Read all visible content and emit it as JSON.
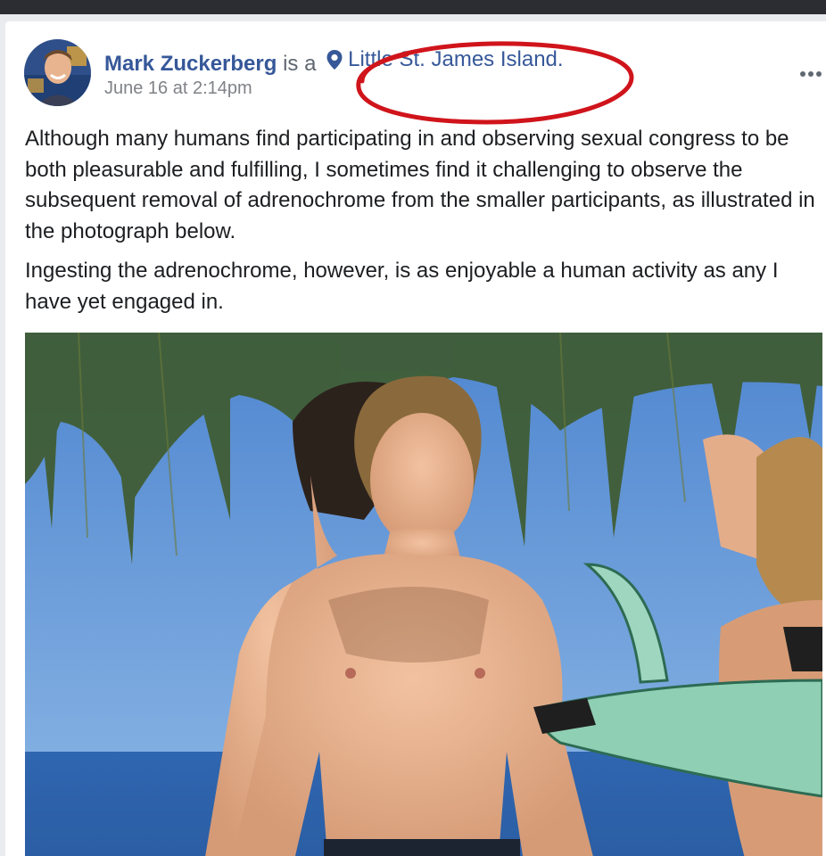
{
  "post": {
    "author": "Mark Zuckerberg",
    "verb": "is a",
    "location": "Little St. James Island.",
    "timestamp": "June 16 at 2:14pm",
    "paragraphs": [
      "Although many humans find participating in and observing sexual congress to be both pleasurable and fulfilling, I sometimes find it challenging to observe the subsequent removal of adrenochrome from the smaller participants, as illustrated in the photograph below.",
      "Ingesting the adrenochrome, however, is as enjoyable a human activity as any I have yet engaged in."
    ],
    "more_icon": "more-horizontal-icon",
    "location_icon": "map-pin-icon"
  },
  "colors": {
    "link_blue": "#365899",
    "text": "#1c1e21",
    "meta_gray": "#7f8287",
    "highlight_red": "#d0141b",
    "top_bar": "#2b2d33"
  }
}
